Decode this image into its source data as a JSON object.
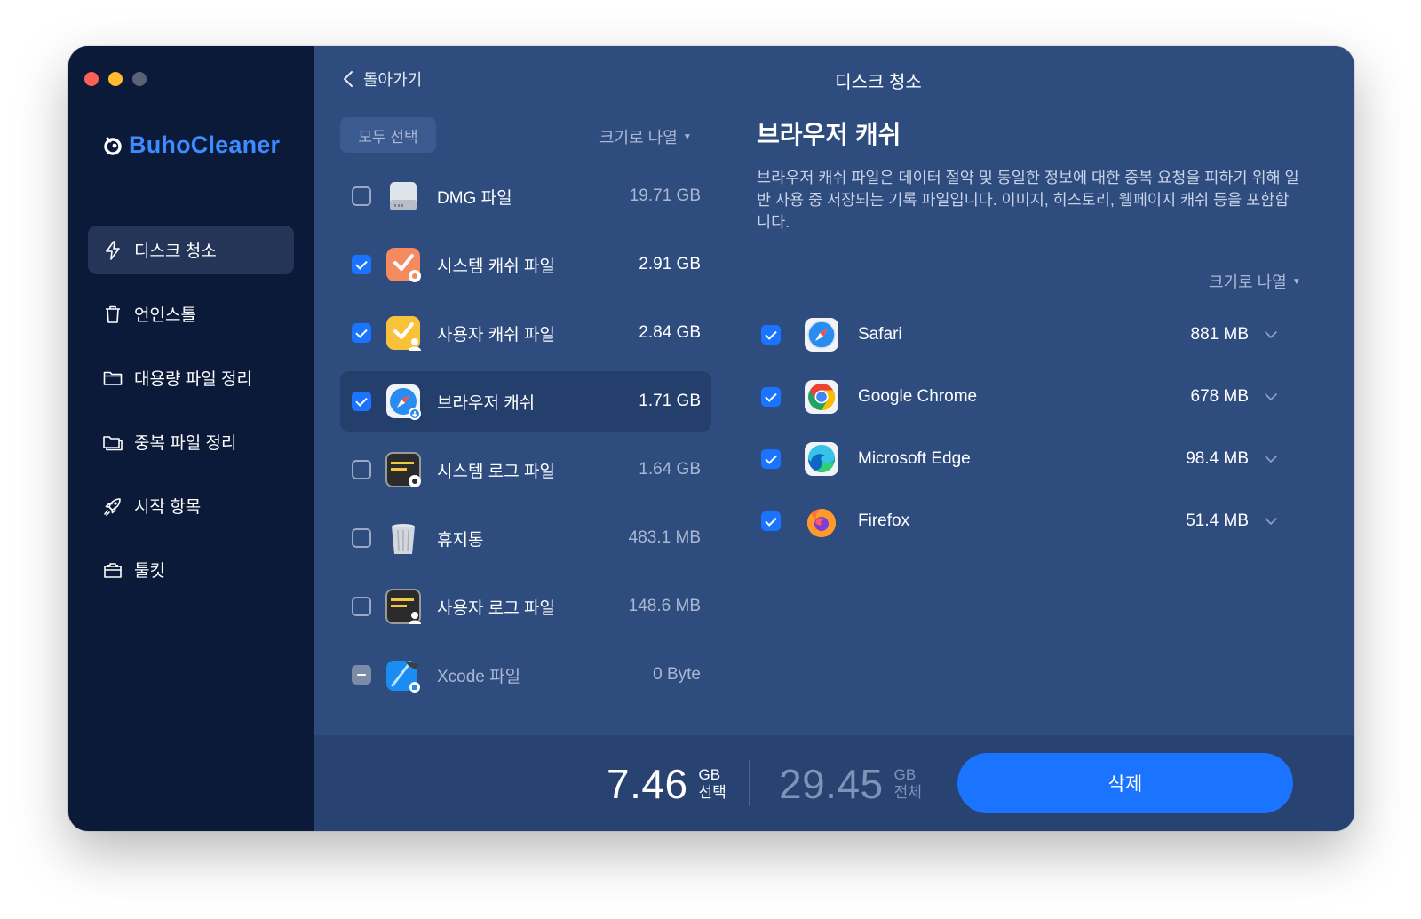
{
  "app": {
    "brand": "BuhoCleaner",
    "page_title": "디스크 청소",
    "back_label": "돌아가기"
  },
  "sidebar": {
    "items": [
      {
        "label": "디스크 청소",
        "icon": "lightning-icon",
        "active": true
      },
      {
        "label": "언인스톨",
        "icon": "trash-icon",
        "active": false
      },
      {
        "label": "대용량 파일 정리",
        "icon": "folder-icon",
        "active": false
      },
      {
        "label": "중복 파일 정리",
        "icon": "duplicate-folder-icon",
        "active": false
      },
      {
        "label": "시작 항목",
        "icon": "rocket-icon",
        "active": false
      },
      {
        "label": "툴킷",
        "icon": "toolbox-icon",
        "active": false
      }
    ]
  },
  "list": {
    "select_all_label": "모두 선택",
    "sort_label": "크기로 나열",
    "items": [
      {
        "name": "DMG 파일",
        "size": "19.71 GB",
        "checked": "off",
        "icon": "disk-drive-icon"
      },
      {
        "name": "시스템 캐쉬 파일",
        "size": "2.91 GB",
        "checked": "on",
        "icon": "system-cache-icon"
      },
      {
        "name": "사용자 캐쉬 파일",
        "size": "2.84 GB",
        "checked": "on",
        "icon": "user-cache-icon"
      },
      {
        "name": "브라우저 캐쉬",
        "size": "1.71 GB",
        "checked": "on",
        "icon": "browser-cache-icon",
        "selected": true
      },
      {
        "name": "시스템 로그 파일",
        "size": "1.64 GB",
        "checked": "off",
        "icon": "system-log-icon"
      },
      {
        "name": "휴지통",
        "size": "483.1 MB",
        "checked": "off",
        "icon": "trash-can-icon"
      },
      {
        "name": "사용자 로그 파일",
        "size": "148.6 MB",
        "checked": "off",
        "icon": "user-log-icon"
      },
      {
        "name": "Xcode 파일",
        "size": "0 Byte",
        "checked": "mixed",
        "icon": "xcode-icon",
        "disabled": true
      }
    ]
  },
  "detail": {
    "title": "브라우저 캐쉬",
    "description": "브라우저 캐쉬 파일은 데이터 절약 및 동일한 정보에 대한 중복 요청을 피하기 위해 일반 사용 중 저장되는 기록 파일입니다. 이미지, 히스토리, 웹페이지 캐쉬 등을 포함합니다.",
    "sort_label": "크기로 나열",
    "browsers": [
      {
        "name": "Safari",
        "size": "881 MB",
        "checked": true,
        "icon": "safari-icon"
      },
      {
        "name": "Google Chrome",
        "size": "678 MB",
        "checked": true,
        "icon": "chrome-icon"
      },
      {
        "name": "Microsoft Edge",
        "size": "98.4 MB",
        "checked": true,
        "icon": "edge-icon"
      },
      {
        "name": "Firefox",
        "size": "51.4 MB",
        "checked": true,
        "icon": "firefox-icon"
      }
    ]
  },
  "footer": {
    "selected_value": "7.46",
    "selected_unit": "GB",
    "selected_label": "선택",
    "total_value": "29.45",
    "total_unit": "GB",
    "total_label": "전체",
    "delete_label": "삭제"
  },
  "colors": {
    "accent": "#1a74ff",
    "brand": "#3d8bff",
    "sidebar_bg": "#0c1a3a",
    "main_bg": "#2f4c7f"
  }
}
